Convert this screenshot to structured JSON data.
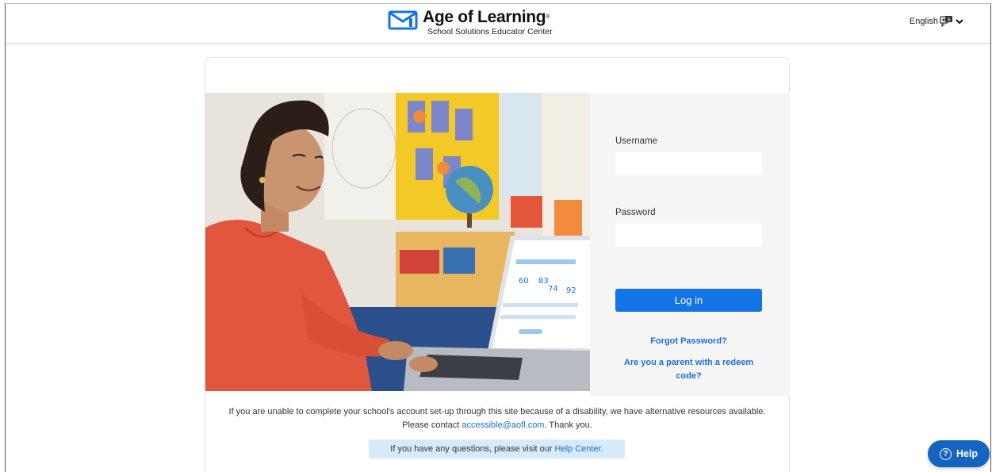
{
  "header": {
    "brand": "Age of Learning",
    "brand_mark": "®",
    "subtitle": "School Solutions Educator Center",
    "language": "English"
  },
  "hero": {
    "image_icon": "teacher-photo",
    "laptop_stats": [
      "60",
      "83",
      "74",
      "92"
    ]
  },
  "login": {
    "username_label": "Username",
    "username_value": "",
    "password_label": "Password",
    "password_value": "",
    "login_button": "Log in",
    "forgot_password": "Forgot Password?",
    "redeem_code_line1": "Are you a parent with a redeem",
    "redeem_code_line2": "code?"
  },
  "notice": {
    "line1": "If you are unable to complete your school's account set-up through this site because of a disability, we have alternative resources available.",
    "line2_prefix": "Please contact ",
    "email": "accessible@aofl.com",
    "line2_suffix": ". Thank you."
  },
  "help_banner": {
    "prefix": "If you have any questions, please visit our",
    "link": "Help Center."
  },
  "help_fab": {
    "icon": "question-circle-icon",
    "label": "Help"
  },
  "colors": {
    "primary": "#1473e6",
    "link": "#1a6fd6",
    "banner": "#d5ebfa",
    "fab": "#1565c0"
  }
}
